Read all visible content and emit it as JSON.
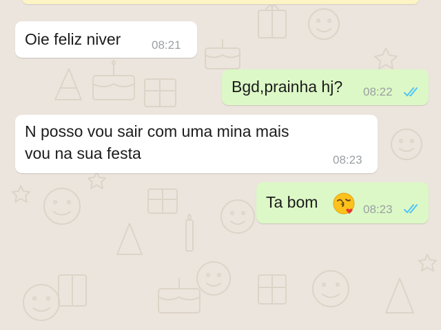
{
  "chat": {
    "colors": {
      "background": "#ece5dd",
      "incoming_bubble": "#ffffff",
      "outgoing_bubble": "#dcf8c6",
      "read_ticks": "#4fc3f7",
      "time_text": "#9aa0a3"
    },
    "messages": [
      {
        "direction": "incoming",
        "text": "Oie feliz niver",
        "time": "08:21"
      },
      {
        "direction": "outgoing",
        "text": "Bgd,prainha hj?",
        "time": "08:22",
        "status": "read-double-check-icon"
      },
      {
        "direction": "incoming",
        "line1": "N posso vou sair com uma mina mais",
        "line2": "vou na sua festa",
        "time": "08:23"
      },
      {
        "direction": "outgoing",
        "text": "Ta bom",
        "emoji": "face-blowing-kiss-emoji",
        "time": "08:23",
        "status": "read-double-check-icon"
      }
    ]
  }
}
